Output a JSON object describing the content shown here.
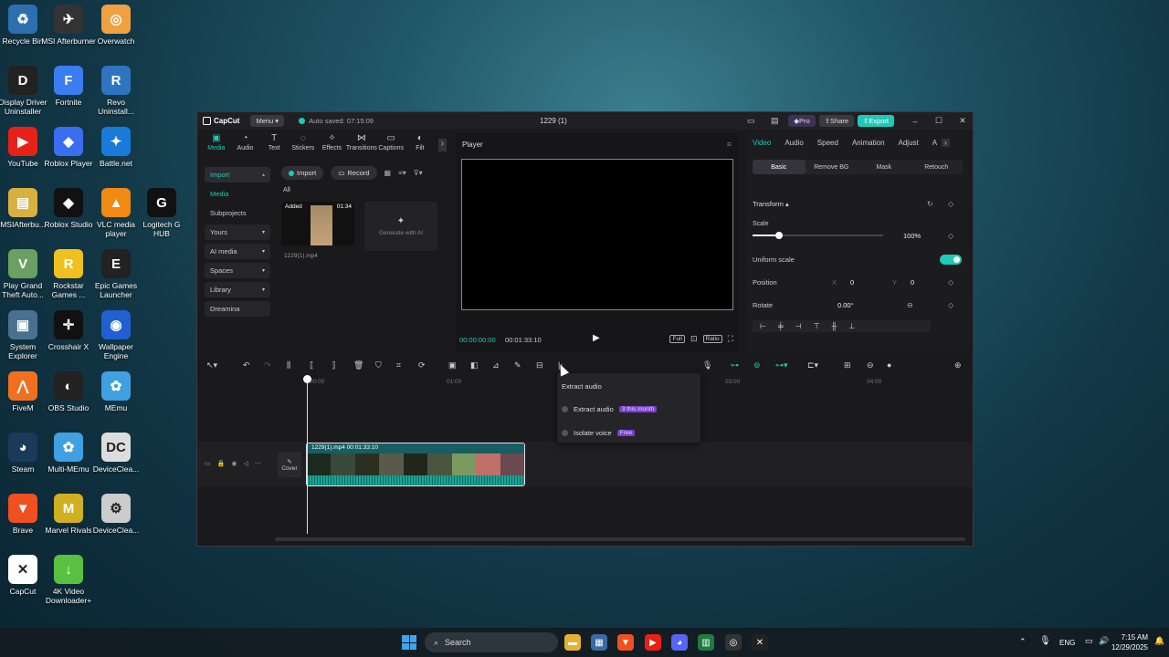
{
  "desktop": {
    "icons": [
      {
        "label": "Recycle Bin",
        "color": "#2b6fb0",
        "glyph": "♻"
      },
      {
        "label": "MSI Afterburner",
        "color": "#333333",
        "glyph": "✈"
      },
      {
        "label": "Overwatch",
        "color": "#f0a040",
        "glyph": "◎"
      },
      {
        "label": "Display Driver Uninstaller",
        "color": "#222222",
        "glyph": "D"
      },
      {
        "label": "Fortnite",
        "color": "#3a7df0",
        "glyph": "F"
      },
      {
        "label": "Revo Uninstall...",
        "color": "#2f74c0",
        "glyph": "R"
      },
      {
        "label": "YouTube",
        "color": "#e62117",
        "glyph": "▶"
      },
      {
        "label": "Roblox Player",
        "color": "#3a6df0",
        "glyph": "◆"
      },
      {
        "label": "Battle.net",
        "color": "#1a7ad8",
        "glyph": "✦"
      },
      {
        "label": "MSIAfterbu...",
        "color": "#d8b040",
        "glyph": "▤"
      },
      {
        "label": "Roblox Studio",
        "color": "#111111",
        "glyph": "◆"
      },
      {
        "label": "VLC media player",
        "color": "#f08a10",
        "glyph": "▲"
      },
      {
        "label": "Logitech G HUB",
        "color": "#111111",
        "glyph": "G"
      },
      {
        "label": "Play Grand Theft Auto...",
        "color": "#6aa060",
        "glyph": "V"
      },
      {
        "label": "Rockstar Games ...",
        "color": "#f0c020",
        "glyph": "R"
      },
      {
        "label": "Epic Games Launcher",
        "color": "#222222",
        "glyph": "E"
      },
      {
        "label": "System Explorer",
        "color": "#4a7090",
        "glyph": "▣"
      },
      {
        "label": "Crosshair X",
        "color": "#111111",
        "glyph": "✛"
      },
      {
        "label": "Wallpaper Engine",
        "color": "#2060d0",
        "glyph": "◉"
      },
      {
        "label": "FiveM",
        "color": "#f07020",
        "glyph": "⋀"
      },
      {
        "label": "OBS Studio",
        "color": "#222222",
        "glyph": "◐"
      },
      {
        "label": "MEmu",
        "color": "#40a0e0",
        "glyph": "✿"
      },
      {
        "label": "Steam",
        "color": "#1b3a5a",
        "glyph": "◕"
      },
      {
        "label": "Multi-MEmu",
        "color": "#40a0e0",
        "glyph": "✿"
      },
      {
        "label": "DeviceClea...",
        "color": "#dddddd",
        "glyph": "DC"
      },
      {
        "label": "Brave",
        "color": "#f05020",
        "glyph": "▼"
      },
      {
        "label": "Marvel Rivals",
        "color": "#d0b020",
        "glyph": "M"
      },
      {
        "label": "DeviceClea...",
        "color": "#cccccc",
        "glyph": "⚙"
      },
      {
        "label": "CapCut",
        "color": "#ffffff",
        "glyph": "✕"
      },
      {
        "label": "4K Video Downloader+",
        "color": "#5ac040",
        "glyph": "↓"
      }
    ]
  },
  "window": {
    "app_name": "CapCut",
    "menu_label": "Menu",
    "autosave": "Auto saved: 07:15:09",
    "project_title": "1229 (1)",
    "pro_label": "Pro",
    "share_label": "Share",
    "export_label": "Export"
  },
  "media_panel": {
    "tool_tabs": [
      {
        "label": "Media",
        "icon": "media-icon"
      },
      {
        "label": "Audio",
        "icon": "audio-icon"
      },
      {
        "label": "Text",
        "icon": "text-icon"
      },
      {
        "label": "Stickers",
        "icon": "stickers-icon"
      },
      {
        "label": "Effects",
        "icon": "effects-icon"
      },
      {
        "label": "Transitions",
        "icon": "transitions-icon"
      },
      {
        "label": "Captions",
        "icon": "captions-icon"
      },
      {
        "label": "Filt",
        "icon": "filters-icon"
      }
    ],
    "nav": [
      "Import",
      "Media",
      "Subprojects",
      "Yours",
      "AI media",
      "Spaces",
      "Library",
      "Dreamina"
    ],
    "import_btn": "Import",
    "record_btn": "Record",
    "filter_all": "All",
    "clip_added": "Added",
    "clip_duration": "01:34",
    "clip_name": "1229(1).mp4",
    "generate_label": "Generate with AI"
  },
  "player": {
    "title": "Player",
    "time_current": "00:00:00:00",
    "time_total": "00:01:33:10",
    "full_label": "Full",
    "ratio_label": "Ratio"
  },
  "properties": {
    "tabs": [
      "Video",
      "Audio",
      "Speed",
      "Animation",
      "Adjust",
      "A"
    ],
    "sub_tabs": [
      "Basic",
      "Remove BG",
      "Mask",
      "Retouch"
    ],
    "transform_label": "Transform",
    "scale_label": "Scale",
    "scale_value": "100%",
    "scale_fraction": 0.2,
    "uniform_scale_label": "Uniform scale",
    "position_label": "Position",
    "pos_x_label": "X",
    "pos_x": "0",
    "pos_y_label": "Y",
    "pos_y": "0",
    "rotate_label": "Rotate",
    "rotate_value": "0.00°"
  },
  "timeline": {
    "ruler": [
      "00:00",
      "01:00",
      "03:00",
      "04:00"
    ],
    "cover_label": "Cover",
    "clip_label": "1229(1).mp4  00:01:33:10"
  },
  "dropdown": {
    "title": "Extract audio",
    "items": [
      {
        "label": "Extract audio",
        "badge": "3 this month"
      },
      {
        "label": "Isolate voice",
        "badge": "Free"
      }
    ]
  },
  "taskbar": {
    "search_placeholder": "Search",
    "lang": "ENG",
    "time": "7:15 AM",
    "date": "12/29/2025"
  }
}
